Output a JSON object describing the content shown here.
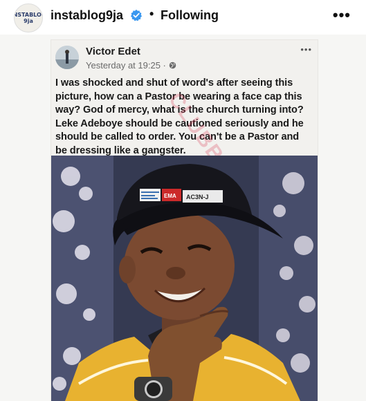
{
  "header": {
    "avatar_text": "INSTABLOG 9ja",
    "username": "instablog9ja",
    "separator": "•",
    "follow_status": "Following",
    "more": "•••",
    "verified_icon": "verified-badge-icon"
  },
  "post": {
    "author": "Victor Edet",
    "timestamp": "Yesterday at 19:25 ·",
    "privacy_icon": "globe-icon",
    "more": "•••",
    "text": "I was shocked and shut of word's after seeing this picture, how can a Pastor be wearing a face cap this way? God of mercy, what is the church turning into? Leke Adeboye should be cautioned seriously and he should be called to order. You can't be a Pastor and be dressing like a gangster.",
    "watermark": "CLUBB",
    "cap_labels": [
      "EMA",
      "AC3N-J"
    ]
  },
  "colors": {
    "verified": "#3897f0",
    "jacket": "#e8b230",
    "cap": "#16161c",
    "background_photo": "#3b4057"
  }
}
